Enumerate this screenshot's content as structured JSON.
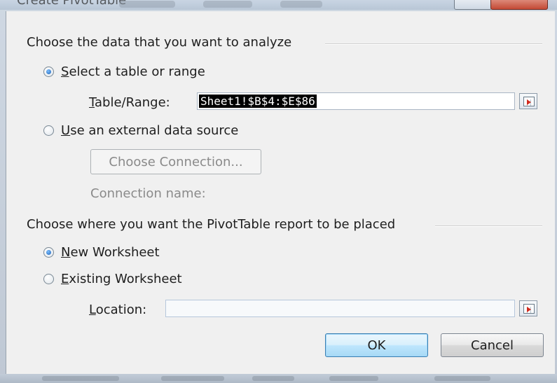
{
  "dialog": {
    "title": "Create PivotTable"
  },
  "section_data": {
    "heading": "Choose the data that you want to analyze",
    "select_table": {
      "label_hotkey": "S",
      "label_rest": "elect a table or range",
      "checked": true
    },
    "table_range": {
      "label_hotkey": "T",
      "label_rest": "able/Range:",
      "value": "Sheet1!$B$4:$E$86"
    },
    "external_source": {
      "label_hotkey": "U",
      "label_rest": "se an external data source",
      "checked": false
    },
    "choose_connection_label": "Choose Connection...",
    "connection_name_label": "Connection name:"
  },
  "section_place": {
    "heading": "Choose where you want the PivotTable report to be placed",
    "new_worksheet": {
      "label_hotkey": "N",
      "label_rest": "ew Worksheet",
      "checked": true
    },
    "existing_worksheet": {
      "label_hotkey": "E",
      "label_rest": "xisting Worksheet",
      "checked": false
    },
    "location": {
      "label_hotkey": "L",
      "label_rest": "ocation:",
      "value": ""
    }
  },
  "buttons": {
    "ok": "OK",
    "cancel": "Cancel"
  },
  "icons": {
    "range_picker": "range-picker-icon"
  },
  "colors": {
    "selection_bg": "#000000",
    "default_button": "#bee6fd",
    "close_button": "#c44a35"
  }
}
